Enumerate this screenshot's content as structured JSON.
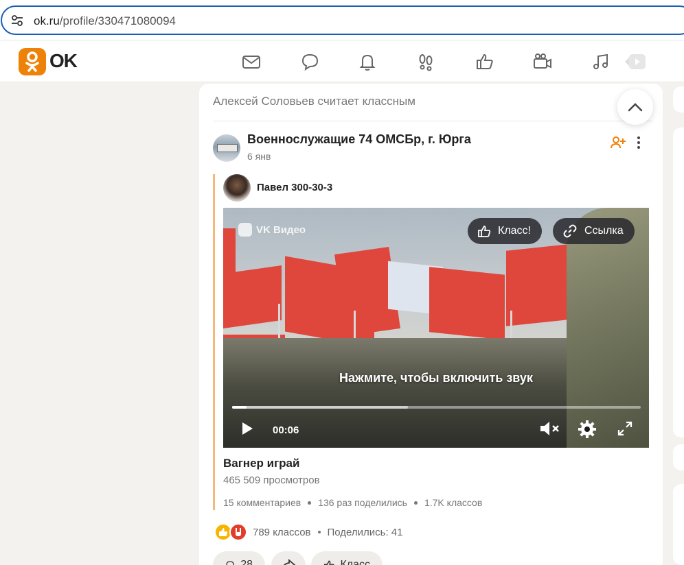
{
  "browser": {
    "url_host": "ok.ru",
    "url_path": "/profile/330471080094"
  },
  "header": {
    "logo_text": "OK",
    "nav": [
      "mail-icon",
      "chat-icon",
      "bell-icon",
      "footprints-icon",
      "thumbs-up-icon",
      "video-camera-icon",
      "music-icon",
      "video-play-icon"
    ]
  },
  "feed": {
    "activity_text": "Алексей Соловьев считает классным",
    "group_name": "Военнослужащие 74 ОМСБр, г. Юрга",
    "post_date": "6 янв",
    "author_name": "Павел 300-30-3",
    "video": {
      "brand": "VK Видео",
      "like_label": "Класс!",
      "link_label": "Ссылка",
      "unmute_hint": "Нажмите, чтобы включить звук",
      "time": "00:06",
      "progress_fraction": 0.036,
      "buffered_fraction": 0.43
    },
    "video_title": "Вагнер играй",
    "views": "465 509 просмотров",
    "stats": {
      "comments": "15 комментариев",
      "shares": "136 раз поделились",
      "likes": "1.7K классов"
    },
    "reactions": {
      "count": "789 классов",
      "shared": "Поделились: 41"
    },
    "actions": {
      "comments_count": "28",
      "like_label": "Класс"
    }
  },
  "colors": {
    "brand_orange": "#ee8208",
    "repost_bar": "#f6b878",
    "flag_red": "#e0473c"
  }
}
